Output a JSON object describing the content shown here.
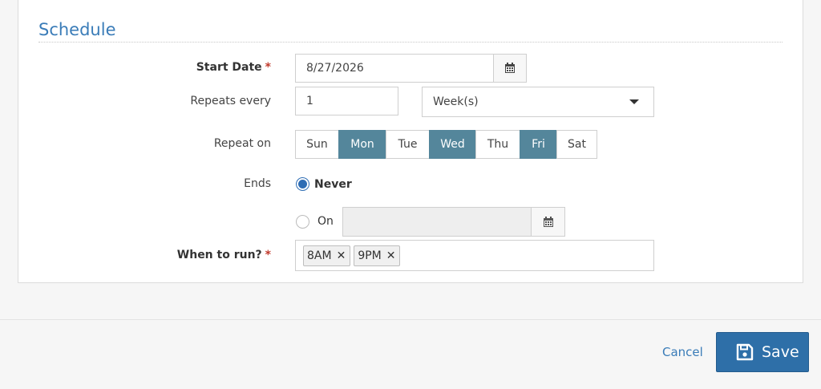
{
  "section": {
    "title": "Schedule"
  },
  "start_date": {
    "label": "Start Date",
    "required_mark": "*",
    "value": "8/27/2026",
    "calendar_icon": "calendar-icon"
  },
  "repeats": {
    "label": "Repeats every",
    "interval_value": "1",
    "unit_selected": "Week(s)"
  },
  "repeat_on": {
    "label": "Repeat on",
    "days": [
      {
        "label": "Sun",
        "selected": false
      },
      {
        "label": "Mon",
        "selected": true
      },
      {
        "label": "Tue",
        "selected": false
      },
      {
        "label": "Wed",
        "selected": true
      },
      {
        "label": "Thu",
        "selected": false
      },
      {
        "label": "Fri",
        "selected": true
      },
      {
        "label": "Sat",
        "selected": false
      }
    ]
  },
  "ends": {
    "label": "Ends",
    "options": [
      {
        "label": "Never",
        "checked": true
      },
      {
        "label": "On",
        "checked": false
      }
    ],
    "on_date_value": ""
  },
  "when_to_run": {
    "label": "When to run?",
    "required_mark": "*",
    "tags": [
      "8AM",
      "9PM"
    ],
    "remove_icon": "close-icon"
  },
  "footer": {
    "cancel_label": "Cancel",
    "save_label": "Save",
    "save_icon": "floppy-disk-icon"
  },
  "colors": {
    "accent": "#3a7cb8",
    "day_selected": "#54869b",
    "save_button": "#2e6fa8",
    "required": "#c0392b"
  }
}
